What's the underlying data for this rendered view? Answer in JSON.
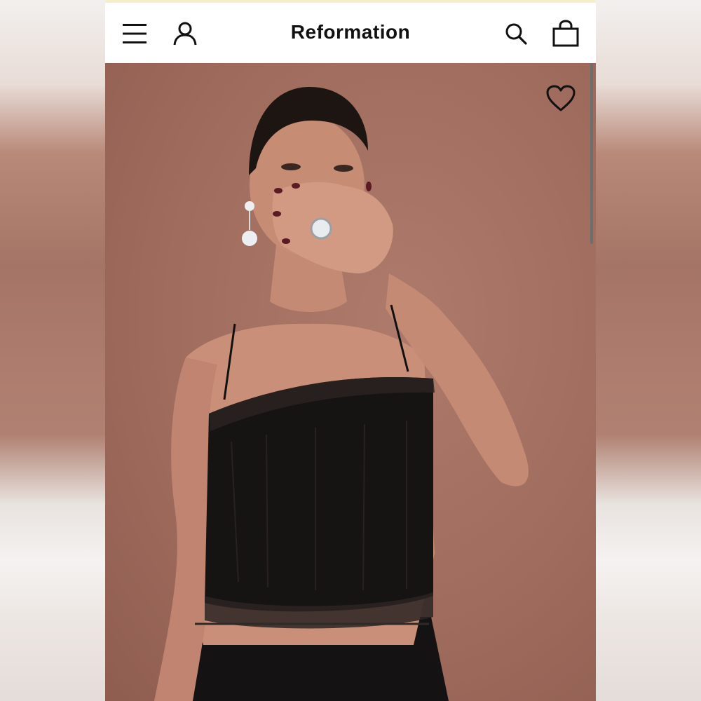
{
  "app": {
    "brand": "Reformation"
  },
  "header": {
    "menu_icon": "menu-icon",
    "account_icon": "account-icon",
    "search_icon": "search-icon",
    "bag_icon": "bag-icon"
  },
  "hero": {
    "favorite_icon": "heart-icon"
  },
  "colors": {
    "promo_strip": "#f6efc9",
    "backdrop": "#a06c5e",
    "icon": "#111111"
  }
}
